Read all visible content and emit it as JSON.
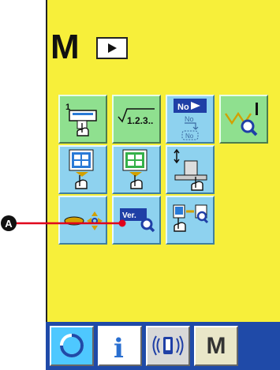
{
  "header": {
    "mode_label": "M"
  },
  "buttons": {
    "counter_badge": "1",
    "step_label": "1.2.3..",
    "no_top_label": "No",
    "no_mid_label": "No",
    "no_bottom_label": "No",
    "version_label": "Ver."
  },
  "footer": {
    "info_label": "i",
    "menu_label": "M"
  },
  "callout": {
    "marker_label": "A"
  },
  "colors": {
    "panel_background": "#f7ef3a",
    "button_green": "#8fe08f",
    "button_blue": "#8ed2ef",
    "footer_background": "#1f4aa8",
    "callout_line": "#e0001b"
  }
}
